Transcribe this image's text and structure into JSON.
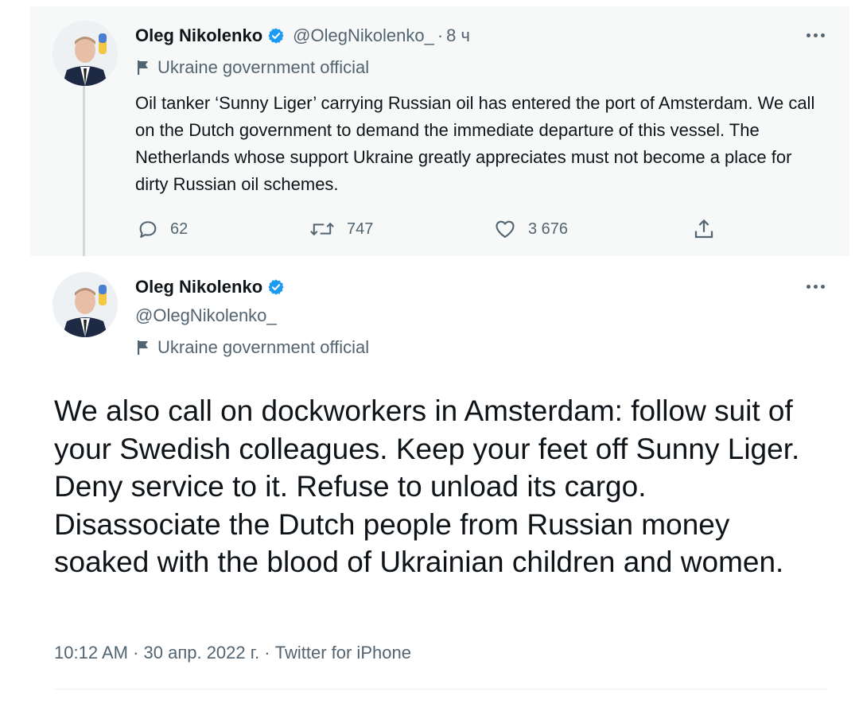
{
  "tweet1": {
    "name": "Oleg Nikolenko",
    "handle": "@OlegNikolenko_",
    "separator": "·",
    "time": "8 ч",
    "label": "Ukraine government official",
    "text": "Oil tanker ‘Sunny Liger’ carrying Russian oil has entered the port of Amsterdam. We call on the Dutch government to demand the immediate departure of this vessel. The Netherlands whose support Ukraine greatly appreciates must not become a place for dirty Russian oil schemes.",
    "replies": "62",
    "retweets": "747",
    "likes": "3 676"
  },
  "tweet2": {
    "name": "Oleg Nikolenko",
    "handle": "@OlegNikolenko_",
    "label": "Ukraine government official",
    "text": "We also call on dockworkers in Amsterdam: follow suit of your Swedish colleagues. Keep your feet off Sunny Liger. Deny service to it. Refuse to unload its cargo. Disassociate the Dutch people from Russian money soaked with the blood of Ukrainian children and women.",
    "meta": "10:12 AM · 30 апр. 2022 г. · Twitter for iPhone"
  },
  "icons": {
    "verified": "verified-badge-icon",
    "flag": "flag-icon",
    "more": "more-icon",
    "reply": "reply-icon",
    "retweet": "retweet-icon",
    "like": "like-icon",
    "share": "share-icon"
  },
  "colors": {
    "verified": "#1d9bf0",
    "muted_text": "#536471",
    "highlight_bg": "#f7f9f9",
    "thread_line": "#cfd9de"
  }
}
